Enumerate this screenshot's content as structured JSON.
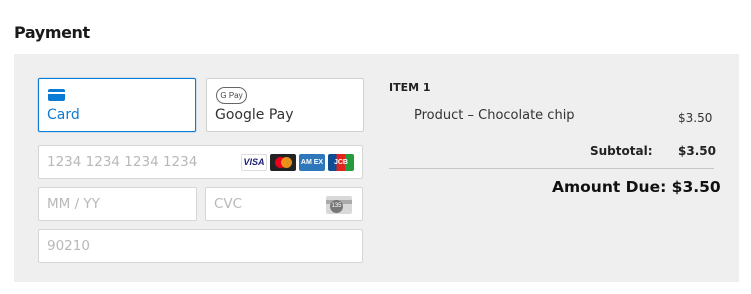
{
  "section": {
    "title": "Payment"
  },
  "methods": {
    "card": {
      "label": "Card",
      "icon": "credit-card-icon"
    },
    "gpay": {
      "label": "Google Pay",
      "icon": "google-pay-icon",
      "badge": "G Pay"
    }
  },
  "form": {
    "card_number": {
      "placeholder": "1234 1234 1234 1234",
      "value": ""
    },
    "card_brands": [
      {
        "name": "visa",
        "text": "VISA"
      },
      {
        "name": "mastercard",
        "text": ""
      },
      {
        "name": "amex",
        "text": "AM EX"
      },
      {
        "name": "jcb",
        "text": "JCB"
      }
    ],
    "expiry": {
      "placeholder": "MM / YY",
      "value": ""
    },
    "cvc": {
      "placeholder": "CVC",
      "value": "",
      "badge": "135"
    },
    "zip": {
      "placeholder": "90210",
      "value": ""
    }
  },
  "summary": {
    "item_heading": "ITEM 1",
    "product_name": "Product – Chocolate chip",
    "product_price": "$3.50",
    "subtotal_label": "Subtotal:",
    "subtotal_value": "$3.50",
    "amount_due": "Amount Due: $3.50"
  },
  "colors": {
    "accent": "#0b7bd4",
    "panel_bg": "#efefef"
  }
}
